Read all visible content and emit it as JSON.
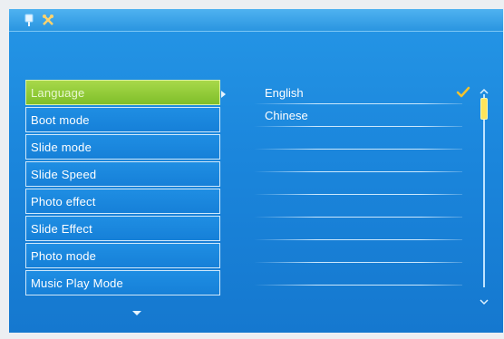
{
  "menu": {
    "items": [
      {
        "label": "Language",
        "selected": true
      },
      {
        "label": "Boot mode"
      },
      {
        "label": "Slide mode"
      },
      {
        "label": "Slide Speed"
      },
      {
        "label": "Photo effect"
      },
      {
        "label": "Slide Effect"
      },
      {
        "label": "Photo mode"
      },
      {
        "label": "Music Play Mode"
      }
    ]
  },
  "options": {
    "items": [
      {
        "label": "English",
        "checked": true
      },
      {
        "label": "Chinese"
      },
      {
        "label": ""
      },
      {
        "label": ""
      },
      {
        "label": ""
      },
      {
        "label": ""
      },
      {
        "label": ""
      },
      {
        "label": ""
      },
      {
        "label": ""
      }
    ]
  },
  "colors": {
    "screen": "#1b86dc",
    "selected_item": "#8fcb34",
    "check": "#f3c22e",
    "scroll_thumb": "#ffe45b"
  },
  "icons": {
    "topbar_left": "pin-icon",
    "topbar_right": "tools-icon",
    "check": "check-icon"
  }
}
